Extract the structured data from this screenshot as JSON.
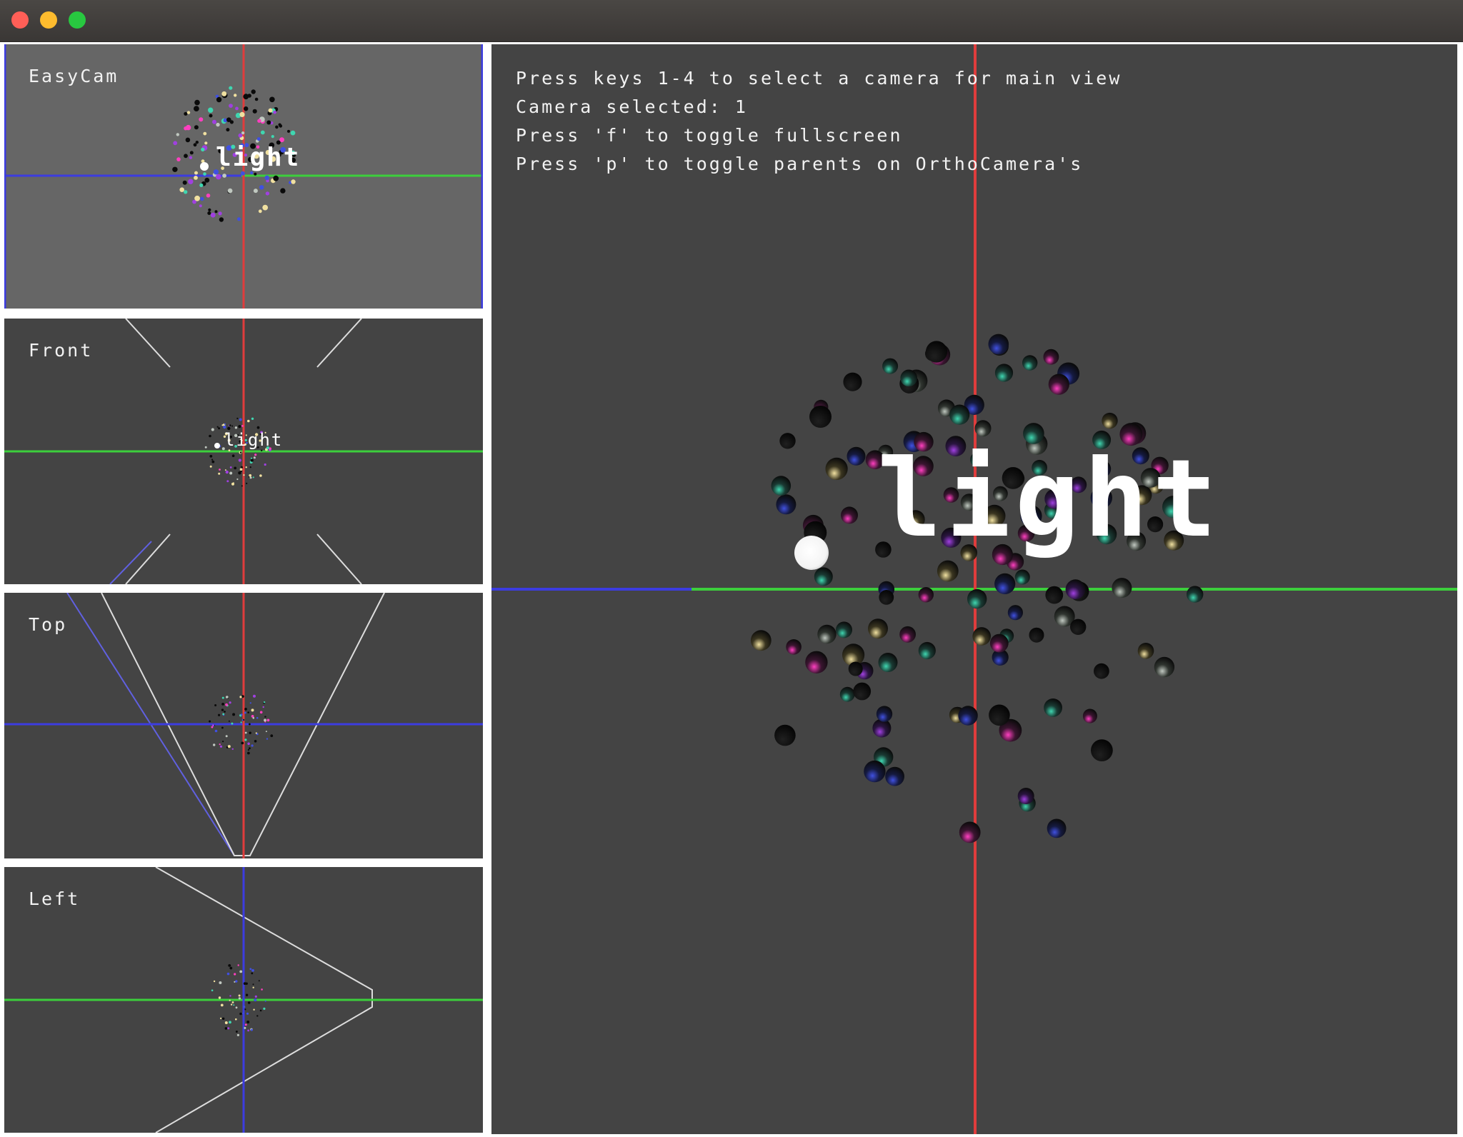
{
  "window": {
    "controls": [
      "close",
      "minimize",
      "maximize"
    ]
  },
  "views": {
    "easycam": {
      "label": "EasyCam"
    },
    "front": {
      "label": "Front"
    },
    "top": {
      "label": "Top"
    },
    "left": {
      "label": "Left"
    }
  },
  "main_view": {
    "instructions": [
      "Press keys 1-4 to select a camera for main view",
      "Camera selected: 1",
      "Press 'f' to toggle fullscreen",
      "Press 'p' to toggle parents on OrthoCamera's"
    ],
    "light_label": "light"
  },
  "colors": {
    "viewport_bg": "#444444",
    "easycam_bg": "#666666",
    "axis_x": "#e03c3c",
    "axis_y": "#3ccf3c",
    "axis_z": "#3c3ce0",
    "frustum": "#dddddd"
  }
}
